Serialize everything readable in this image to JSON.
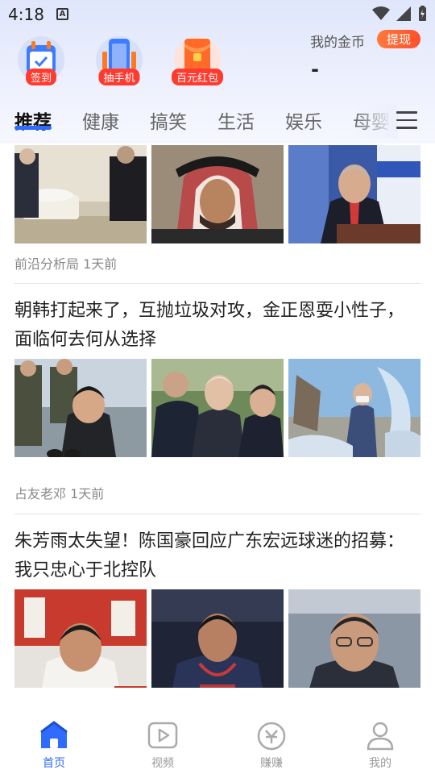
{
  "status_bar": {
    "time": "4:18",
    "badge": "A"
  },
  "quick_actions": [
    {
      "label": "签到",
      "icon": "calendar-icon"
    },
    {
      "label": "抽手机",
      "icon": "phone-icon"
    },
    {
      "label": "百元红包",
      "icon": "red-envelope-icon"
    }
  ],
  "coins": {
    "label": "我的金币",
    "withdraw_label": "提现",
    "value": "-"
  },
  "tabs": [
    "推荐",
    "健康",
    "搞笑",
    "生活",
    "娱乐",
    "母婴"
  ],
  "feed": [
    {
      "source": "前沿分析局",
      "time": "1天前"
    },
    {
      "headline": "朝韩打起来了，互抛垃圾对攻，金正恩耍小性子，面临何去何从选择",
      "source": "占友老邓",
      "time": "1天前"
    },
    {
      "headline": "朱芳雨太失望！陈国豪回应广东宏远球迷的招募：我只忠心于北控队"
    }
  ],
  "bottom_nav": [
    {
      "label": "首页",
      "icon": "home-icon",
      "active": true
    },
    {
      "label": "视频",
      "icon": "video-play-icon"
    },
    {
      "label": "赚赚",
      "icon": "earn-coin-icon"
    },
    {
      "label": "我的",
      "icon": "user-icon"
    }
  ],
  "colors": {
    "accent": "#2f6bff",
    "badge_red": "#ff3b2f",
    "withdraw_orange": "#ff5a2a"
  }
}
